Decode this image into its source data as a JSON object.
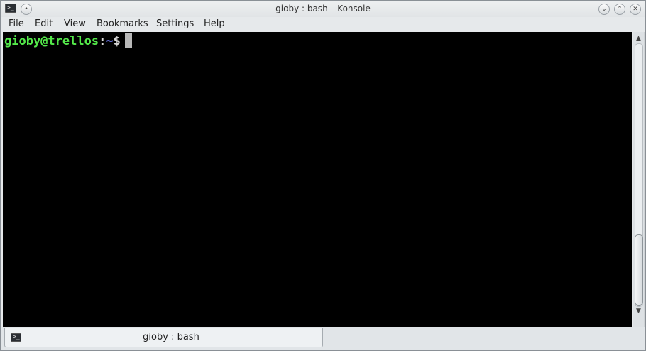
{
  "window": {
    "title": "gioby : bash – Konsole",
    "icon": "terminal-icon",
    "icon_glyph": ">_",
    "menu_button_glyph": "•",
    "controls": {
      "minimize_glyph": "⌄",
      "maximize_glyph": "⌃",
      "close_glyph": "✕"
    }
  },
  "menubar": {
    "items": [
      "File",
      "Edit",
      "View",
      "Bookmarks",
      "Settings",
      "Help"
    ]
  },
  "terminal": {
    "user_host": "gioby@trellos",
    "separator": ":",
    "path": "~",
    "symbol": "$",
    "colors": {
      "user_host": "#54e94a",
      "path": "#6f7cf5",
      "symbol": "#d8d8d8",
      "background": "#000000"
    }
  },
  "scrollbar": {
    "up_glyph": "▲",
    "down_glyph": "▼",
    "position": 1.0,
    "visible_fraction": 0.27
  },
  "tabs": [
    {
      "label": "gioby : bash",
      "icon": "terminal-icon",
      "icon_glyph": ">_"
    }
  ]
}
